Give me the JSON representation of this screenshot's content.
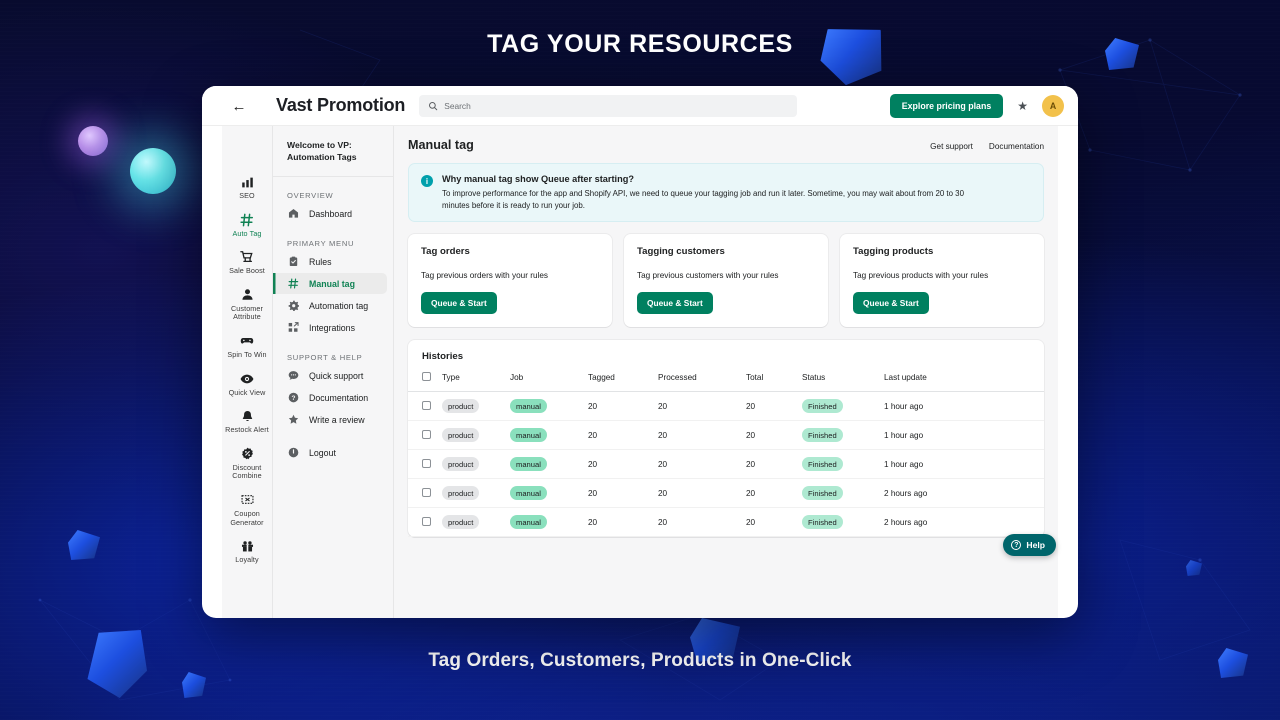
{
  "headline": "TAG YOUR RESOURCES",
  "caption": "Tag Orders, Customers, Products in One-Click",
  "colors": {
    "accent_green": "#008060",
    "active_green": "#108254",
    "info_teal": "#00a0ac",
    "help_teal": "#00656b",
    "avatar_amber": "#f2c14b",
    "background_navy": "#060a2b"
  },
  "topbar": {
    "back_icon": "back-arrow-icon",
    "brand": "Vast Promotion",
    "search_placeholder": "Search",
    "search_value": "",
    "search_icon": "search-icon",
    "pricing_button": "Explore pricing plans",
    "star_icon": "star-icon",
    "avatar_initial": "A"
  },
  "rail": {
    "items": [
      {
        "label": "SEO",
        "icon": "bar-chart-icon",
        "active": false
      },
      {
        "label": "Auto Tag",
        "icon": "hash-icon",
        "active": true
      },
      {
        "label": "Sale Boost",
        "icon": "shopping-cart-icon",
        "active": false
      },
      {
        "label": "Customer Attribute",
        "icon": "person-icon",
        "active": false
      },
      {
        "label": "Spin To Win",
        "icon": "game-controller-icon",
        "active": false
      },
      {
        "label": "Quick View",
        "icon": "eye-icon",
        "active": false
      },
      {
        "label": "Restock Alert",
        "icon": "bell-icon",
        "active": false
      },
      {
        "label": "Discount Combine",
        "icon": "discount-badge-icon",
        "active": false
      },
      {
        "label": "Coupon Generator",
        "icon": "coupon-icon",
        "active": false
      },
      {
        "label": "Loyalty",
        "icon": "gift-icon",
        "active": false
      }
    ]
  },
  "sidebar": {
    "welcome": "Welcome to VP: Automation Tags",
    "sections": [
      {
        "title": "OVERVIEW",
        "items": [
          {
            "label": "Dashboard",
            "icon": "home-icon",
            "active": false
          }
        ]
      },
      {
        "title": "PRIMARY MENU",
        "items": [
          {
            "label": "Rules",
            "icon": "clipboard-check-icon",
            "active": false
          },
          {
            "label": "Manual tag",
            "icon": "hash-icon",
            "active": true
          },
          {
            "label": "Automation tag",
            "icon": "gear-icon",
            "active": false
          },
          {
            "label": "Integrations",
            "icon": "integrations-icon",
            "active": false
          }
        ]
      },
      {
        "title": "SUPPORT & HELP",
        "items": [
          {
            "label": "Quick support",
            "icon": "chat-icon",
            "active": false
          },
          {
            "label": "Documentation",
            "icon": "question-circle-icon",
            "active": false
          },
          {
            "label": "Write a review",
            "icon": "star-icon",
            "active": false
          }
        ]
      }
    ],
    "logout": {
      "label": "Logout",
      "icon": "power-icon"
    }
  },
  "main": {
    "title": "Manual tag",
    "links": [
      "Get support",
      "Documentation"
    ],
    "banner": {
      "icon": "info-icon",
      "title": "Why manual tag show Queue after starting?",
      "body": "To improve performance for the app and Shopify API, we need to queue your tagging job and run it later. Sometime, you may wait about from 20 to 30 minutes before it is ready to run your job."
    },
    "cards": [
      {
        "title": "Tag orders",
        "desc": "Tag previous orders with your rules",
        "button": "Queue & Start"
      },
      {
        "title": "Tagging customers",
        "desc": "Tag previous customers with your rules",
        "button": "Queue & Start"
      },
      {
        "title": "Tagging products",
        "desc": "Tag previous products with your rules",
        "button": "Queue & Start"
      }
    ],
    "histories": {
      "title": "Histories",
      "columns": [
        "",
        "Type",
        "Job",
        "Tagged",
        "Processed",
        "Total",
        "Status",
        "Last update"
      ],
      "rows": [
        {
          "type": "product",
          "job": "manual",
          "tagged": "20",
          "processed": "20",
          "total": "20",
          "status": "Finished",
          "last_update": "1 hour ago"
        },
        {
          "type": "product",
          "job": "manual",
          "tagged": "20",
          "processed": "20",
          "total": "20",
          "status": "Finished",
          "last_update": "1 hour ago"
        },
        {
          "type": "product",
          "job": "manual",
          "tagged": "20",
          "processed": "20",
          "total": "20",
          "status": "Finished",
          "last_update": "1 hour ago"
        },
        {
          "type": "product",
          "job": "manual",
          "tagged": "20",
          "processed": "20",
          "total": "20",
          "status": "Finished",
          "last_update": "2 hours ago"
        },
        {
          "type": "product",
          "job": "manual",
          "tagged": "20",
          "processed": "20",
          "total": "20",
          "status": "Finished",
          "last_update": "2 hours ago"
        }
      ]
    }
  },
  "help_widget": {
    "label": "Help",
    "icon": "question-circle-icon"
  }
}
